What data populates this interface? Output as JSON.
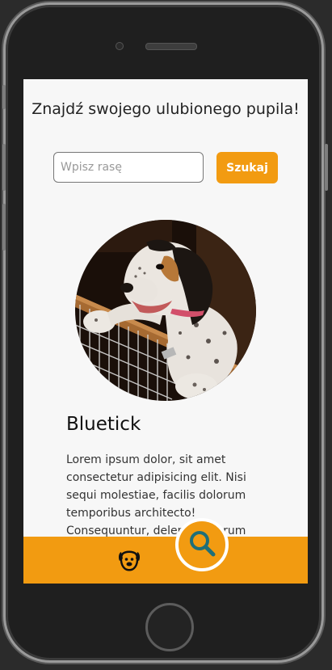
{
  "header": {
    "title": "Znajdź swojego ulubionego pupila!"
  },
  "search": {
    "placeholder": "Wpisz rasę",
    "value": "",
    "button_label": "Szukaj"
  },
  "result": {
    "breed": "Bluetick",
    "description": "Lorem ipsum dolor, sit amet consectetur adipisicing elit. Nisi sequi molestiae, facilis dolorum temporibus architecto! Consequuntur, deleniti dolorum"
  },
  "bottom_nav": {
    "items": [
      {
        "icon": "dog-face-icon"
      },
      {
        "icon": "search-icon"
      }
    ]
  },
  "colors": {
    "accent": "#f29b11",
    "screen_bg": "#f7f7f7",
    "frame": "#1f1f1f"
  }
}
